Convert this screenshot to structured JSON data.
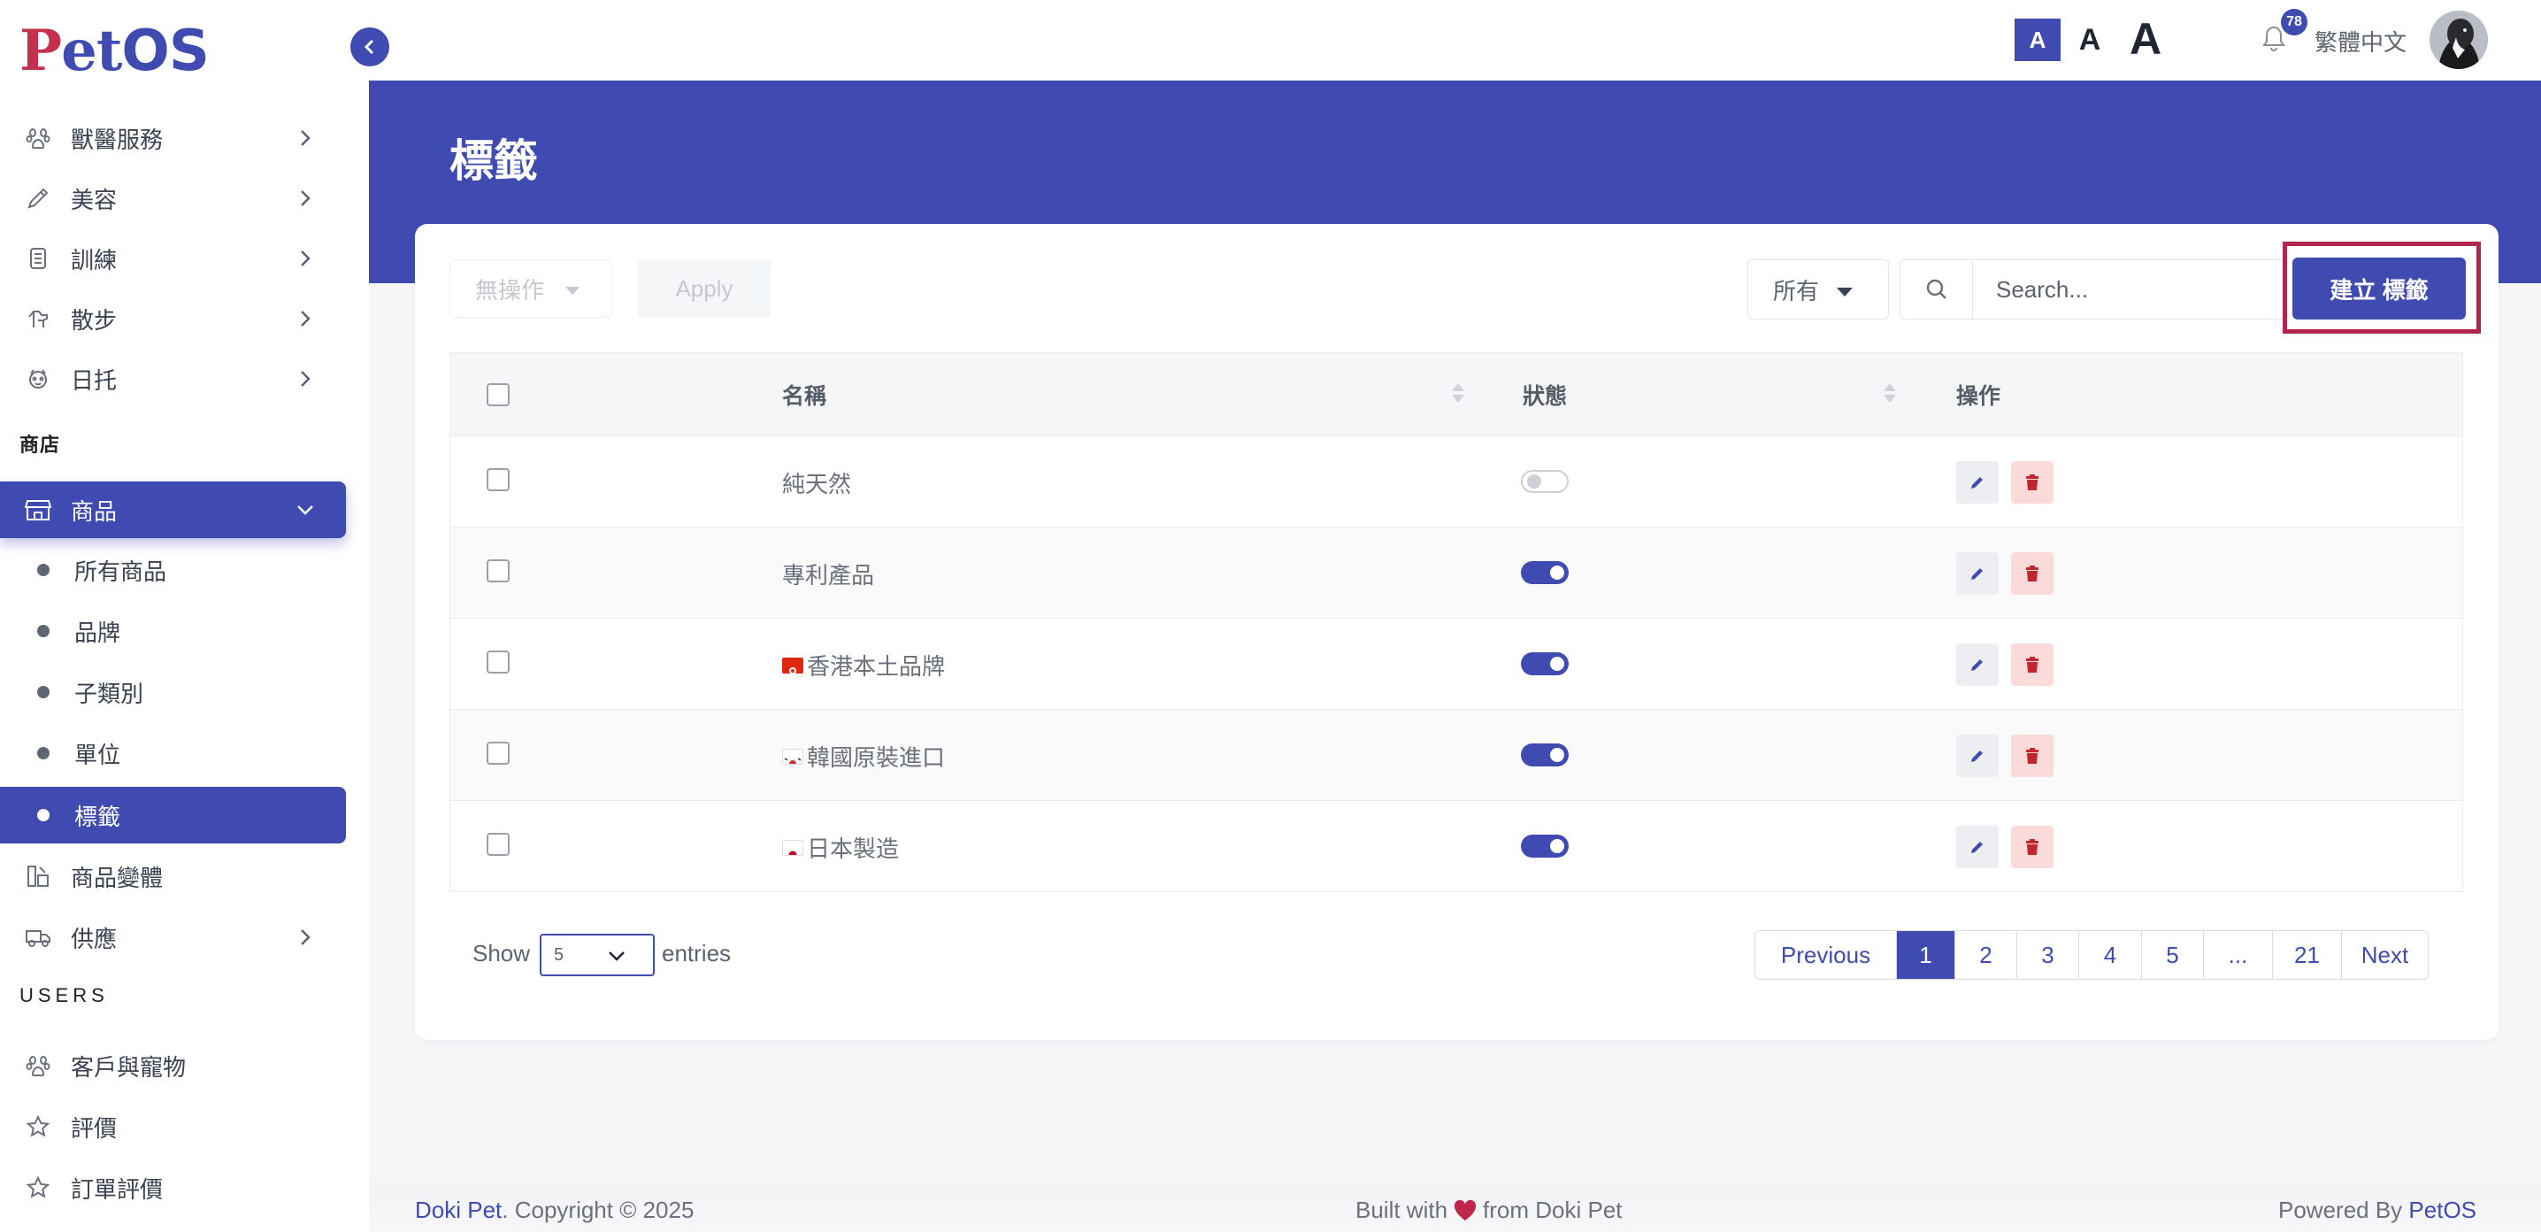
{
  "logo": {
    "part1": "P",
    "part2": "et",
    "part3": "OS"
  },
  "header": {
    "font_sizes": [
      "A",
      "A",
      "A"
    ],
    "notification_count": "78",
    "language": "繁體中文"
  },
  "sidebar": {
    "items_top": [
      {
        "label": "獸醫服務",
        "icon": "paw-icon"
      },
      {
        "label": "美容",
        "icon": "brush-icon"
      },
      {
        "label": "訓練",
        "icon": "badge-icon"
      },
      {
        "label": "散步",
        "icon": "dog-walk-icon"
      },
      {
        "label": "日托",
        "icon": "daycare-icon"
      }
    ],
    "section_shop": "商店",
    "products": {
      "label": "商品"
    },
    "sub_items": [
      {
        "label": "所有商品"
      },
      {
        "label": "品牌"
      },
      {
        "label": "子類別"
      },
      {
        "label": "單位"
      },
      {
        "label": "標籤"
      }
    ],
    "variants": {
      "label": "商品變體"
    },
    "supply": {
      "label": "供應"
    },
    "section_users": "USERS",
    "users_items": [
      {
        "label": "客戶與寵物"
      },
      {
        "label": "評價"
      },
      {
        "label": "訂單評價"
      }
    ]
  },
  "page": {
    "title": "標籤"
  },
  "toolbar": {
    "bulk_action": "無操作",
    "apply": "Apply",
    "filter": "所有",
    "search_placeholder": "Search...",
    "create": "建立 標籤"
  },
  "table": {
    "headers": {
      "name": "名稱",
      "status": "狀態",
      "actions": "操作"
    },
    "rows": [
      {
        "name": "純天然",
        "flag": "",
        "active": false
      },
      {
        "name": "專利產品",
        "flag": "",
        "active": true
      },
      {
        "name": "香港本土品牌",
        "flag": "hk",
        "active": true
      },
      {
        "name": "韓國原裝進口",
        "flag": "kr",
        "active": true
      },
      {
        "name": "日本製造",
        "flag": "jp",
        "active": true
      }
    ]
  },
  "pagination": {
    "show": "Show",
    "entries_value": "5",
    "entries": "entries",
    "pages": [
      "Previous",
      "1",
      "2",
      "3",
      "4",
      "5",
      "...",
      "21",
      "Next"
    ],
    "current": "1"
  },
  "footer": {
    "brand": "Doki Pet",
    "copyright": ". Copyright © 2025",
    "built_pre": "Built with",
    "built_post": "from Doki Pet",
    "powered_pre": "Powered By",
    "powered_brand": "PetOS"
  },
  "colors": {
    "primary": "#3f4bb0",
    "brand_red": "#c6304f",
    "highlight": "#b2254f",
    "delete": "#c0262d"
  }
}
